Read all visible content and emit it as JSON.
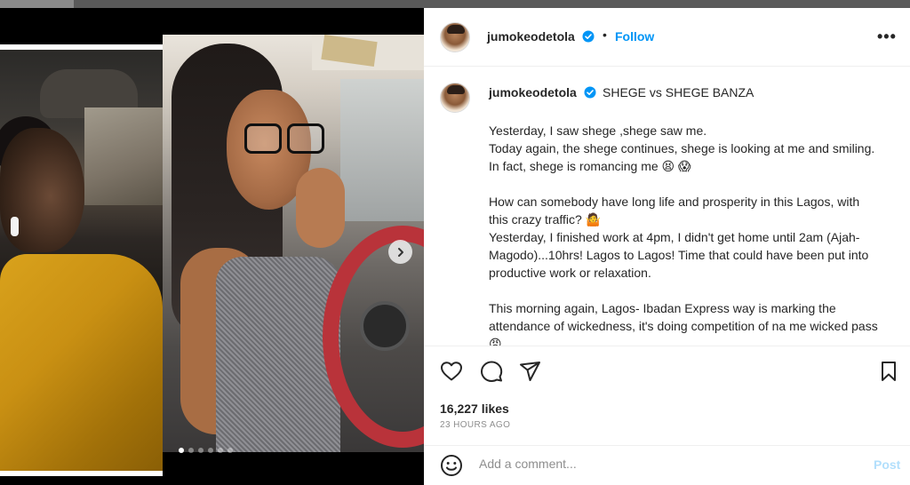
{
  "post": {
    "username": "jumokeodetola",
    "follow_label": "Follow",
    "separator": "•",
    "more_label": "•••",
    "caption_title": "SHEGE vs SHEGE BANZA",
    "caption_body": "Yesterday, I saw shege ,shege saw me.\nToday again, the shege continues, shege is looking at me and smiling. In fact, shege is romancing me 😫 😱\n\nHow can somebody have long life and prosperity in this Lagos, with this crazy traffic? 🤷\nYesterday, I finished work at 4pm, I didn't get home until 2am (Ajah-Magodo)...10hrs! Lagos to Lagos! Time that could have been put into productive work or relaxation.\n\nThis morning again, Lagos- Ibadan Express way is marking the attendance of wickedness, it's doing competition of na me wicked pass😡",
    "likes": "16,227 likes",
    "time_ago": "23 HOURS AGO",
    "comment_placeholder": "Add a comment...",
    "post_label": "Post",
    "carousel": {
      "count": 6,
      "active_index": 0
    }
  },
  "colors": {
    "accent": "#0095f6",
    "verified": "#0095f6",
    "post_disabled": "#b2dffc",
    "text": "#262626",
    "muted": "#8e8e8e"
  },
  "icons": {
    "like": "heart-icon",
    "comment": "comment-icon",
    "share": "paper-plane-icon",
    "save": "bookmark-icon",
    "emoji": "smiley-icon",
    "next": "chevron-right-icon",
    "verified": "verified-badge-icon"
  }
}
